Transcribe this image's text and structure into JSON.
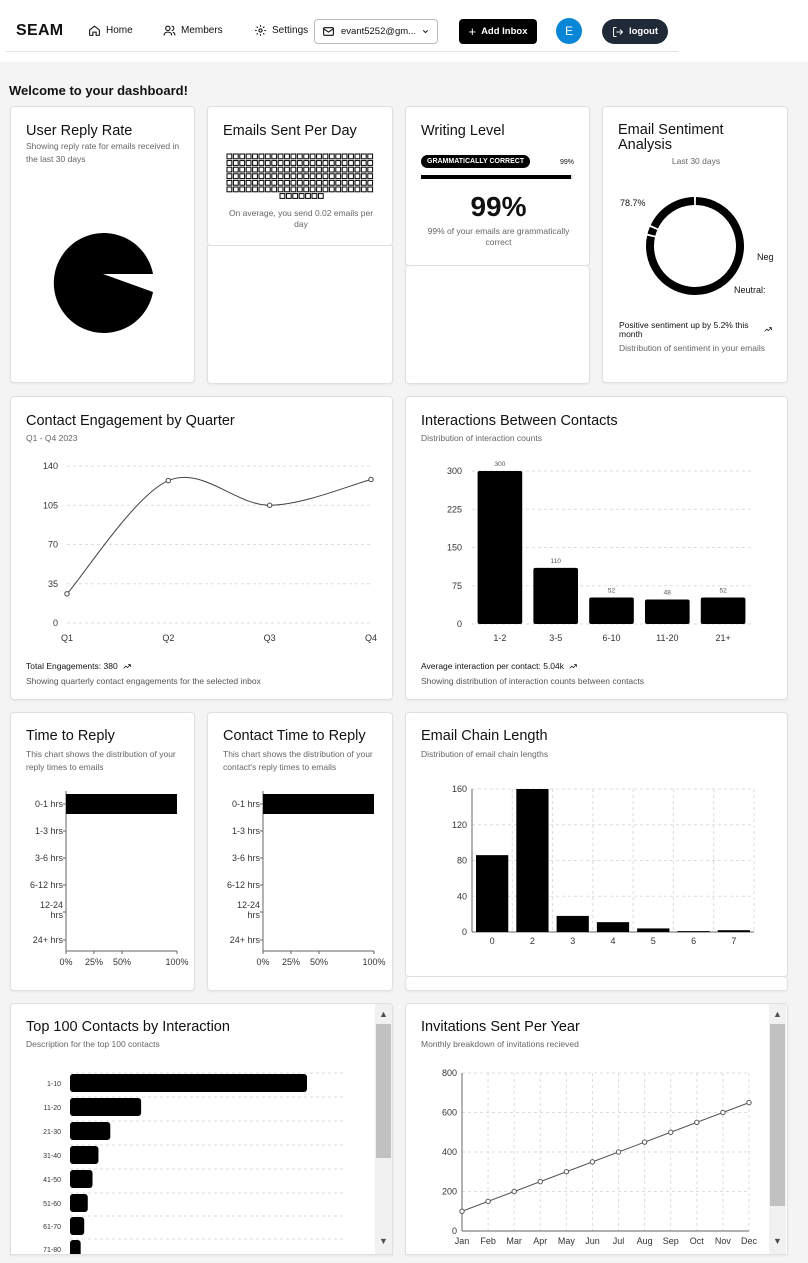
{
  "nav": {
    "brand": "SEAM",
    "home": "Home",
    "members": "Members",
    "settings": "Settings",
    "inbox_value": "evant5252@gm...",
    "add_inbox": "Add Inbox",
    "avatar_letter": "E",
    "logout": "logout"
  },
  "welcome": "Welcome to your dashboard!",
  "reply_rate": {
    "title": "User Reply Rate",
    "subtitle": "Showing reply rate for emails received in the last 30 days",
    "chart_data": {
      "type": "pie",
      "values": [
        94,
        6
      ]
    }
  },
  "emails_sent": {
    "title": "Emails Sent Per Day",
    "caption": "On average, you send 0.02 emails per day"
  },
  "writing": {
    "title": "Writing Level",
    "badge": "GRAMMATICALLY CORRECT",
    "pct_label": "99%",
    "big": "99%",
    "caption": "99% of your emails are grammatically correct",
    "progress": 0.99
  },
  "sentiment": {
    "title": "Email Sentiment Analysis",
    "subtitle": "Last 30 days",
    "pos_label": "78.7%",
    "neg_label": "Neg",
    "neutral_label": "Neutral:",
    "trend": "Positive sentiment up by 5.2% this month",
    "foot": "Distribution of sentiment in your emails",
    "chart_data": {
      "type": "pie",
      "values": [
        78.7,
        3,
        18.3
      ]
    }
  },
  "engagement": {
    "title": "Contact Engagement by Quarter",
    "subtitle": "Q1 - Q4 2023",
    "foot1": "Total Engagements: 380",
    "foot2": "Showing quarterly contact engagements for the selected inbox",
    "chart_data": {
      "type": "line",
      "categories": [
        "Q1",
        "Q2",
        "Q3",
        "Q4"
      ],
      "values": [
        26,
        127,
        105,
        128
      ],
      "yticks": [
        0,
        35,
        70,
        105,
        140
      ],
      "ylim": [
        0,
        140
      ]
    }
  },
  "interactions": {
    "title": "Interactions Between Contacts",
    "subtitle": "Distribution of interaction counts",
    "foot1": "Average interaction per contact: 5.04k",
    "foot2": "Showing distribution of interaction counts between contacts",
    "chart_data": {
      "type": "bar",
      "categories": [
        "1-2",
        "3-5",
        "6-10",
        "11-20",
        "21+"
      ],
      "values": [
        300,
        110,
        52,
        48,
        52
      ],
      "yticks": [
        0,
        75,
        150,
        225,
        300
      ],
      "ylim": [
        0,
        300
      ]
    }
  },
  "time_to_reply": {
    "title": "Time to Reply",
    "subtitle": "This chart shows the distribution of your reply times to emails",
    "chart_data": {
      "type": "bar",
      "categories": [
        "0-1 hrs",
        "1-3 hrs",
        "3-6 hrs",
        "6-12 hrs",
        "12-24 hrs",
        "24+ hrs"
      ],
      "values": [
        100,
        0,
        0,
        0,
        0,
        0
      ],
      "xticks": [
        "0%",
        "25%",
        "50%",
        "100%"
      ]
    }
  },
  "contact_time_to_reply": {
    "title": "Contact Time to Reply",
    "subtitle": "This chart shows the distribution of your contact's reply times to emails",
    "chart_data": {
      "type": "bar",
      "categories": [
        "0-1 hrs",
        "1-3 hrs",
        "3-6 hrs",
        "6-12 hrs",
        "12-24 hrs",
        "24+ hrs"
      ],
      "values": [
        100,
        0,
        0,
        0,
        0,
        0
      ],
      "xticks": [
        "0%",
        "25%",
        "50%",
        "100%"
      ]
    }
  },
  "chain_length": {
    "title": "Email Chain Length",
    "subtitle": "Distribution of email chain lengths",
    "chart_data": {
      "type": "bar",
      "categories": [
        "0",
        "2",
        "3",
        "4",
        "5",
        "6",
        "7"
      ],
      "values": [
        86,
        160,
        18,
        11,
        4,
        1,
        2
      ],
      "yticks": [
        0,
        40,
        80,
        120,
        160
      ],
      "ylim": [
        0,
        160
      ]
    }
  },
  "top_contacts": {
    "title": "Top 100 Contacts by Interaction",
    "subtitle": "Description for the top 100 contacts",
    "chart_data": {
      "type": "bar",
      "categories": [
        "1-10",
        "11-20",
        "21-30",
        "31-40",
        "41-50",
        "51-60",
        "61-70",
        "71-80"
      ],
      "values": [
        100,
        30,
        17,
        12,
        9.5,
        7.5,
        6,
        4.5
      ]
    }
  },
  "invitations": {
    "title": "Invitations Sent Per Year",
    "subtitle": "Monthly breakdown of invitations recieved",
    "chart_data": {
      "type": "line",
      "categories": [
        "Jan",
        "Feb",
        "Mar",
        "Apr",
        "May",
        "Jun",
        "Jul",
        "Aug",
        "Sep",
        "Oct",
        "Nov",
        "Dec"
      ],
      "values": [
        100,
        150,
        200,
        250,
        300,
        350,
        400,
        450,
        500,
        550,
        600,
        650
      ],
      "yticks": [
        0,
        200,
        400,
        600,
        800
      ],
      "ylim": [
        0,
        800
      ]
    }
  }
}
